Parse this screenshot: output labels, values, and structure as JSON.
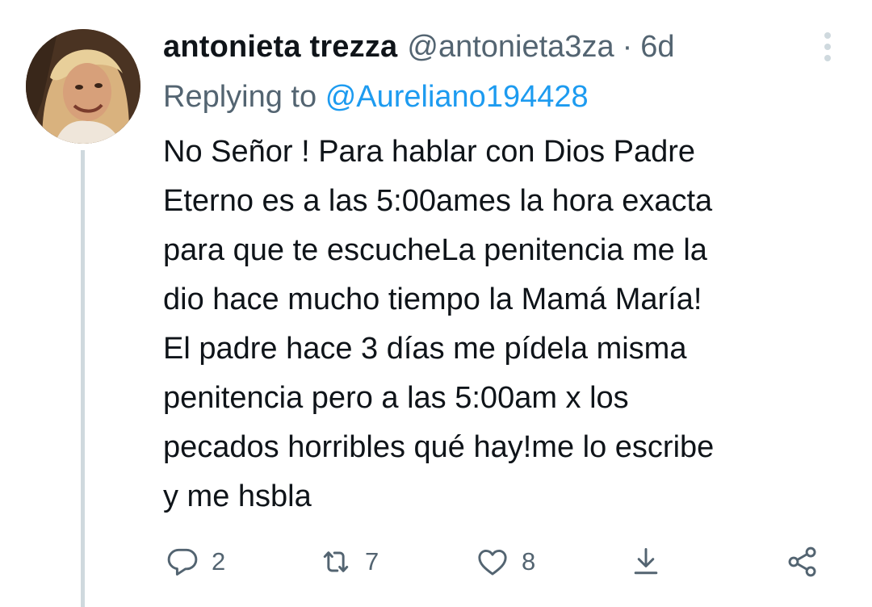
{
  "author": {
    "name": "antonieta trezza",
    "handle": "@antonieta3za",
    "separator": "·",
    "time": "6d"
  },
  "reply": {
    "prefix": "Replying to",
    "mention": "@Aureliano194428"
  },
  "body_lines": [
    "No Señor ! Para hablar con Dios Padre",
    "Eterno es a las 5:00ames la hora exacta",
    "para que te escucheLa penitencia me la",
    "dio hace mucho tiempo la Mamá María!",
    "El padre hace 3 días me pídela misma",
    "penitencia pero a las 5:00am x los",
    "pecados horribles qué hay!me lo escribe",
    "y me hsbla"
  ],
  "actions": {
    "reply_count": "2",
    "retweet_count": "7",
    "like_count": "8"
  },
  "icons": {
    "more": "more-vertical-icon",
    "reply": "reply-bubble-icon",
    "retweet": "retweet-icon",
    "like": "heart-icon",
    "download": "download-icon",
    "share": "share-icon"
  },
  "colors": {
    "text": "#0f1419",
    "secondary": "#536471",
    "link": "#1d9bf0",
    "thread_line": "#cfd9de"
  }
}
